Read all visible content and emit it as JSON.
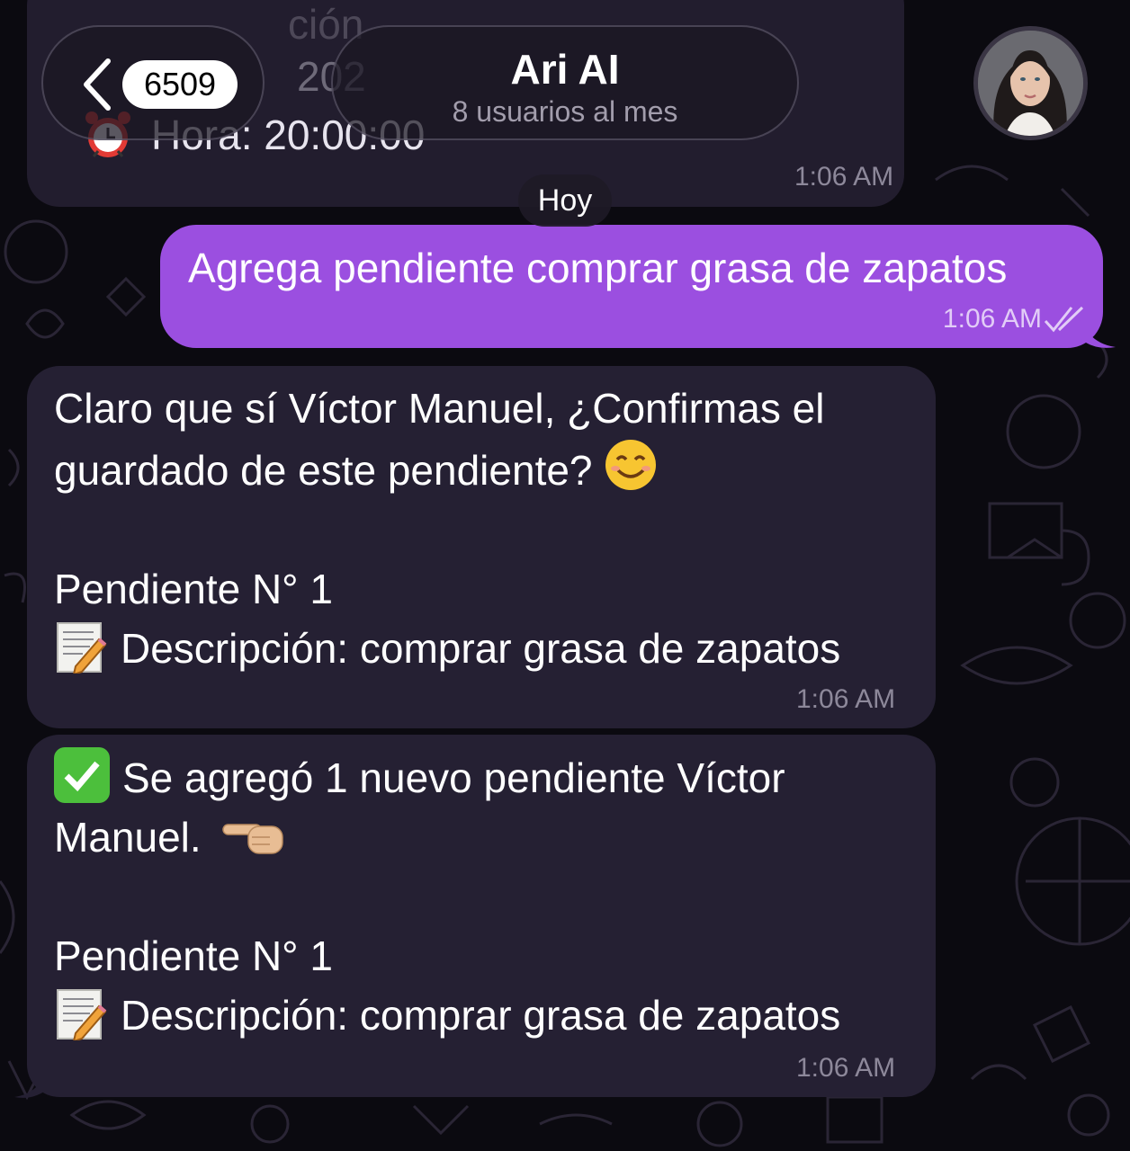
{
  "header": {
    "back_count": "6509",
    "title": "Ari AI",
    "subtitle": "8 usuarios al mes"
  },
  "previous_message": {
    "hora_line": "Hora: 20:00:00",
    "partial_year": "202",
    "partial_text": "ción",
    "time": "1:06 AM"
  },
  "date_separator": "Hoy",
  "messages": [
    {
      "direction": "outgoing",
      "text": "Agrega pendiente comprar grasa de zapatos",
      "time": "1:06 AM",
      "status": "read"
    },
    {
      "direction": "incoming",
      "line1": "Claro que sí Víctor Manuel, ¿Confirmas el",
      "line2": "guardado de este pendiente?",
      "line3": "Pendiente N° 1",
      "line4": "Descripción: comprar grasa de zapatos",
      "time": "1:06 AM"
    },
    {
      "direction": "incoming",
      "line1": "Se agregó 1 nuevo pendiente Víctor",
      "line2": "Manuel.",
      "line3": "Pendiente N° 1",
      "line4": "Descripción: comprar grasa de zapatos",
      "time": "1:06 AM"
    }
  ],
  "icons": {
    "back": "chevron-left-icon",
    "alarm": "alarm-clock-icon",
    "smile": "smiling-face-icon",
    "memo": "memo-pencil-icon",
    "check": "check-mark-box-icon",
    "point": "pointing-left-hand-icon",
    "read": "double-check-icon"
  },
  "colors": {
    "outgoing_bubble": "#9b4fe0",
    "incoming_bubble": "#252033",
    "background": "#0b0a10"
  }
}
